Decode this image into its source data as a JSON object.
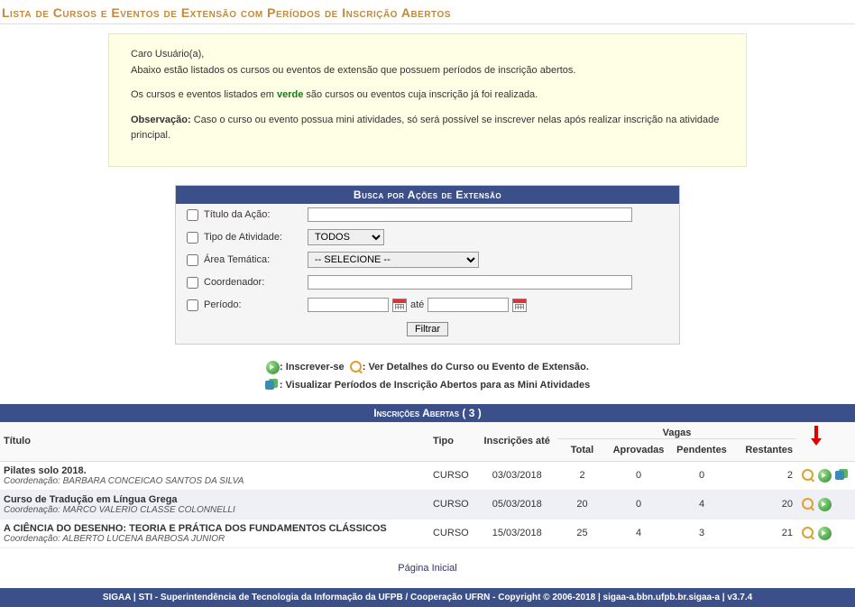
{
  "page_title": "Lista de Cursos e Eventos de Extensão com Períodos de Inscrição Abertos",
  "notice": {
    "greeting": "Caro Usuário(a),",
    "line1": "Abaixo estão listados os cursos ou eventos de extensão que possuem períodos de inscrição abertos.",
    "line2a": "Os cursos e eventos listados em ",
    "line2green": "verde",
    "line2b": " são cursos ou eventos cuja inscrição já foi realizada.",
    "obs_label": "Observação:",
    "obs_text": " Caso o curso ou evento possua mini atividades, só será possível se inscrever nelas após realizar inscrição na atividade principal."
  },
  "search": {
    "title": "Busca por Ações de Extensão",
    "titulo_label": "Título da Ação:",
    "tipo_label": "Tipo de Atividade:",
    "tipo_selected": "TODOS",
    "area_label": "Área Temática:",
    "area_selected": "-- SELECIONE --",
    "coord_label": "Coordenador:",
    "periodo_label": "Período:",
    "ate": "até",
    "filter_button": "Filtrar"
  },
  "legend": {
    "enroll": ": Inscrever-se",
    "details": ": Ver Detalhes do Curso ou Evento de Extensão.",
    "mini": ": Visualizar Períodos de Inscrição Abertos para as Mini Atividades"
  },
  "table": {
    "header": "Inscrições Abertas ( 3 )",
    "cols": {
      "titulo": "Título",
      "tipo": "Tipo",
      "inscricoes_ate": "Inscrições até",
      "vagas": "Vagas",
      "total": "Total",
      "aprovadas": "Aprovadas",
      "pendentes": "Pendentes",
      "restantes": "Restantes"
    },
    "coord_prefix": "Coordenação: ",
    "rows": [
      {
        "titulo": "Pilates solo 2018.",
        "coord": "BARBARA CONCEICAO SANTOS DA SILVA",
        "tipo": "CURSO",
        "ate": "03/03/2018",
        "total": "2",
        "aprovadas": "0",
        "pendentes": "0",
        "restantes": "2",
        "has_mini": true
      },
      {
        "titulo": "Curso de Tradução em Língua Grega",
        "coord": "MARCO VALERIO CLASSE COLONNELLI",
        "tipo": "CURSO",
        "ate": "05/03/2018",
        "total": "20",
        "aprovadas": "0",
        "pendentes": "4",
        "restantes": "20",
        "has_mini": false
      },
      {
        "titulo": "A CIÊNCIA DO DESENHO: TEORIA E PRÁTICA DOS FUNDAMENTOS CLÁSSICOS",
        "coord": "ALBERTO LUCENA BARBOSA JUNIOR",
        "tipo": "CURSO",
        "ate": "15/03/2018",
        "total": "25",
        "aprovadas": "4",
        "pendentes": "3",
        "restantes": "21",
        "has_mini": false
      }
    ]
  },
  "home_link": "Página Inicial",
  "footer": "SIGAA | STI - Superintendência de Tecnologia da Informação da UFPB / Cooperação UFRN - Copyright © 2006-2018 | sigaa-a.bbn.ufpb.br.sigaa-a | v3.7.4"
}
